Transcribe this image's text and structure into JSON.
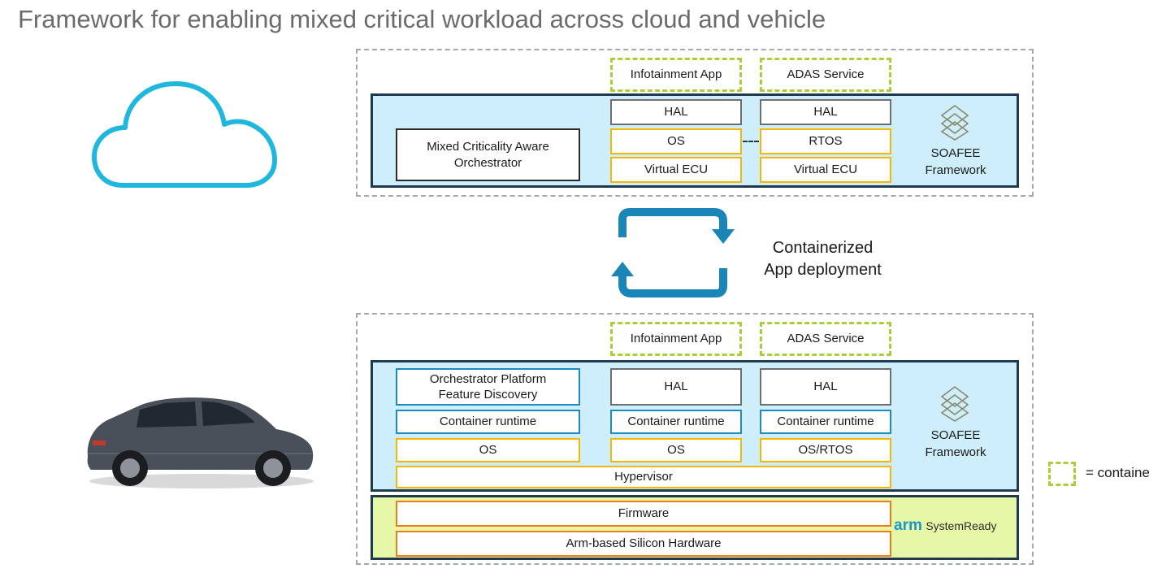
{
  "title": "Framework for enabling mixed critical workload across cloud and vehicle",
  "cloud_section": {
    "containers": [
      "Infotainment App",
      "ADAS Service"
    ],
    "orchestrator": "Mixed Criticality Aware Orchestrator",
    "col1": {
      "hal": "HAL",
      "os": "OS",
      "ecu": "Virtual ECU"
    },
    "col2": {
      "hal": "HAL",
      "os": "RTOS",
      "ecu": "Virtual ECU"
    },
    "soafee_line1": "SOAFEE",
    "soafee_line2": "Framework"
  },
  "deployment": {
    "line1": "Containerized",
    "line2": "App deployment"
  },
  "vehicle_section": {
    "containers": [
      "Infotainment App",
      "ADAS Service"
    ],
    "orchestrator_platform": "Orchestrator Platform Feature Discovery",
    "col0": {
      "runtime": "Container runtime",
      "os": "OS"
    },
    "col1": {
      "hal": "HAL",
      "runtime": "Container runtime",
      "os": "OS"
    },
    "col2": {
      "hal": "HAL",
      "runtime": "Container runtime",
      "os": "OS/RTOS"
    },
    "hypervisor": "Hypervisor",
    "soafee_line1": "SOAFEE",
    "soafee_line2": "Framework",
    "firmware": "Firmware",
    "hardware": "Arm-based Silicon Hardware",
    "arm_logo": "arm",
    "systemready": "SystemReady"
  },
  "legend": {
    "label": "= containe"
  },
  "colors": {
    "panel_blue": "#cdeefa",
    "panel_green": "#e6f7a8",
    "container_dash": "#a8cf3a",
    "os_yellow": "#f5b700",
    "runtime_blue": "#1f8ac0",
    "orange": "#f07c1a",
    "cloud": "#1fb7dd",
    "arrow": "#1a86b8"
  },
  "icons": [
    "cloud-icon",
    "car-image",
    "refresh-arrows-icon",
    "soafee-logo-icon"
  ]
}
